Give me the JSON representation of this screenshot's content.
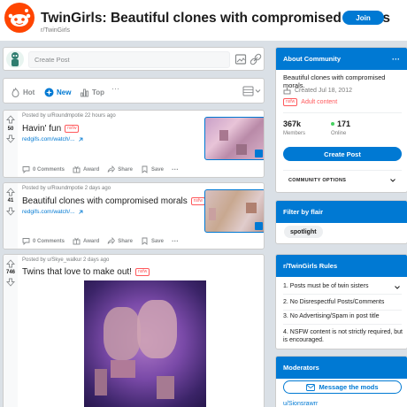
{
  "header": {
    "title": "TwinGirls: Beautiful clones with compromised morals",
    "subreddit": "r/TwinGirls",
    "join_label": "Join"
  },
  "create_post": {
    "placeholder": "Create Post"
  },
  "sort": {
    "tabs": [
      {
        "label": "Hot",
        "icon": "flame-icon",
        "active": false
      },
      {
        "label": "New",
        "icon": "sparkle-icon",
        "active": true
      },
      {
        "label": "Top",
        "icon": "bar-chart-icon",
        "active": false
      }
    ],
    "more_label": "···"
  },
  "posts": [
    {
      "votes": "50",
      "meta": "Posted by u/Roundmpotie 22 hours ago",
      "title": "Havin' fun",
      "nsfw": "nsfw",
      "link": "redgifs.com/watch/...",
      "comments": "0 Comments",
      "award": "Award",
      "share": "Share",
      "save": "Save"
    },
    {
      "votes": "41",
      "meta": "Posted by u/Roundmpotie 2 days ago",
      "title": "Beautiful clones with compromised morals",
      "nsfw": "nsfw",
      "link": "redgifs.com/watch/...",
      "comments": "0 Comments",
      "award": "Award",
      "share": "Share",
      "save": "Save"
    },
    {
      "votes": "746",
      "meta": "Posted by u/Skye_walkur 2 days ago",
      "title": "Twins that love to make out!",
      "nsfw": "nsfw"
    }
  ],
  "about": {
    "heading": "About Community",
    "more": "···",
    "description": "Beautiful clones with compromised morals.",
    "created": "Created Jul 18, 2012",
    "nsfw_tag": "nsfw",
    "adult": "Adult content",
    "members_count": "367k",
    "members_label": "Members",
    "online_count": "171",
    "online_label": "Online",
    "create_post": "Create Post",
    "community_options": "COMMUNITY OPTIONS"
  },
  "flair": {
    "heading": "Filter by flair",
    "chip": "spotlight"
  },
  "rules": {
    "heading": "r/TwinGirls Rules",
    "items": [
      "1. Posts must be of twin sisters",
      "2. No Disrespectful Posts/Comments",
      "3. No Advertising/Spam in post title",
      "4. NSFW content is not strictly required, but is encouraged."
    ]
  },
  "moderators": {
    "heading": "Moderators",
    "message_label": "Message the mods",
    "first_mod": "u/Sionsrawrr"
  },
  "colors": {
    "accent": "#0079d3",
    "nsfw": "#ff585b",
    "brand": "#ff4500",
    "online": "#46d160"
  }
}
